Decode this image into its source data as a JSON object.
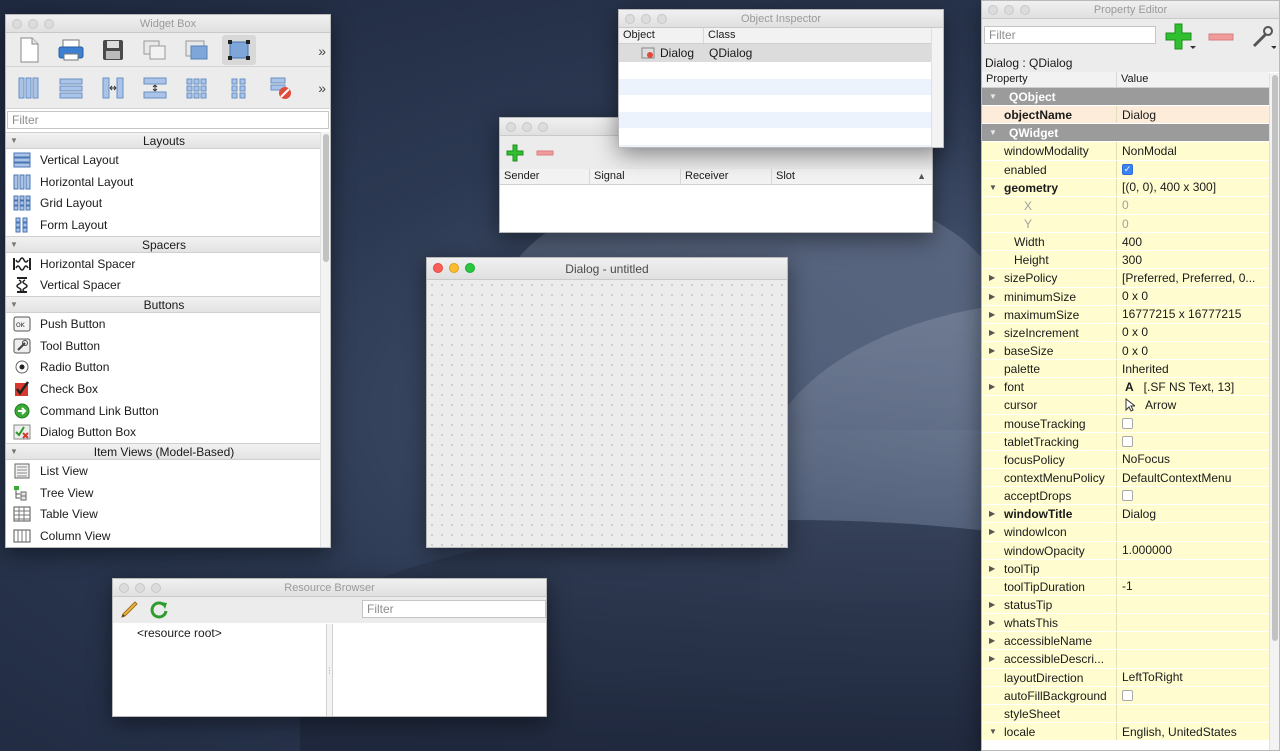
{
  "colors": {
    "accent": "#3b82f6",
    "prop_bg": "#fffdcf",
    "obj_bg": "#fdecd9",
    "category_bg": "#9b9b9b"
  },
  "widget_box": {
    "title": "Widget Box",
    "filter_placeholder": "Filter",
    "categories": [
      {
        "label": "Layouts",
        "items": [
          "Vertical Layout",
          "Horizontal Layout",
          "Grid Layout",
          "Form Layout"
        ]
      },
      {
        "label": "Spacers",
        "items": [
          "Horizontal Spacer",
          "Vertical Spacer"
        ]
      },
      {
        "label": "Buttons",
        "items": [
          "Push Button",
          "Tool Button",
          "Radio Button",
          "Check Box",
          "Command Link Button",
          "Dialog Button Box"
        ]
      },
      {
        "label": "Item Views (Model-Based)",
        "items": [
          "List View",
          "Tree View",
          "Table View",
          "Column View"
        ]
      }
    ]
  },
  "object_inspector": {
    "title": "Object Inspector",
    "col_object": "Object",
    "col_class": "Class",
    "row_object": "Dialog",
    "row_class": "QDialog"
  },
  "signal_editor": {
    "col_sender": "Sender",
    "col_signal": "Signal",
    "col_receiver": "Receiver",
    "col_slot": "Slot"
  },
  "dialog": {
    "title": "Dialog - untitled"
  },
  "resource_browser": {
    "title": "Resource Browser",
    "filter_placeholder": "Filter",
    "root": "<resource root>"
  },
  "property_editor": {
    "title": "Property Editor",
    "filter_placeholder": "Filter",
    "object_label": "Dialog : QDialog",
    "col_property": "Property",
    "col_value": "Value",
    "rows": [
      {
        "name": "QObject",
        "value": "",
        "kind": "cat",
        "arrow": "▼"
      },
      {
        "name": "objectName",
        "value": "Dialog",
        "kind": "o",
        "bold": true
      },
      {
        "name": "QWidget",
        "value": "",
        "kind": "cat",
        "arrow": "▼"
      },
      {
        "name": "windowModality",
        "value": "NonModal",
        "kind": "y"
      },
      {
        "name": "enabled",
        "value": "",
        "kind": "y",
        "checkbox": "on"
      },
      {
        "name": "geometry",
        "value": "[(0, 0), 400 x 300]",
        "kind": "y",
        "bold": true,
        "arrow": "▼"
      },
      {
        "name": "X",
        "value": "0",
        "kind": "y",
        "indent": 2,
        "disabled": true
      },
      {
        "name": "Y",
        "value": "0",
        "kind": "y",
        "indent": 2,
        "disabled": true
      },
      {
        "name": "Width",
        "value": "400",
        "kind": "y",
        "indent": 1
      },
      {
        "name": "Height",
        "value": "300",
        "kind": "y",
        "indent": 1
      },
      {
        "name": "sizePolicy",
        "value": "[Preferred, Preferred, 0...",
        "kind": "y",
        "arrow": "▶"
      },
      {
        "name": "minimumSize",
        "value": "0 x 0",
        "kind": "y",
        "arrow": "▶"
      },
      {
        "name": "maximumSize",
        "value": "16777215 x 16777215",
        "kind": "y",
        "arrow": "▶"
      },
      {
        "name": "sizeIncrement",
        "value": "0 x 0",
        "kind": "y",
        "arrow": "▶"
      },
      {
        "name": "baseSize",
        "value": "0 x 0",
        "kind": "y",
        "arrow": "▶"
      },
      {
        "name": "palette",
        "value": "Inherited",
        "kind": "y"
      },
      {
        "name": "font",
        "value": "[.SF NS Text, 13]",
        "kind": "y",
        "arrow": "▶",
        "icon": "font"
      },
      {
        "name": "cursor",
        "value": "Arrow",
        "kind": "y",
        "icon": "cursor"
      },
      {
        "name": "mouseTracking",
        "value": "",
        "kind": "y",
        "checkbox": "off"
      },
      {
        "name": "tabletTracking",
        "value": "",
        "kind": "y",
        "checkbox": "off"
      },
      {
        "name": "focusPolicy",
        "value": "NoFocus",
        "kind": "y"
      },
      {
        "name": "contextMenuPolicy",
        "value": "DefaultContextMenu",
        "kind": "y"
      },
      {
        "name": "acceptDrops",
        "value": "",
        "kind": "y",
        "checkbox": "off"
      },
      {
        "name": "windowTitle",
        "value": "Dialog",
        "kind": "y",
        "bold": true,
        "arrow": "▶"
      },
      {
        "name": "windowIcon",
        "value": "",
        "kind": "y",
        "arrow": "▶"
      },
      {
        "name": "windowOpacity",
        "value": "1.000000",
        "kind": "y"
      },
      {
        "name": "toolTip",
        "value": "",
        "kind": "y",
        "arrow": "▶"
      },
      {
        "name": "toolTipDuration",
        "value": "-1",
        "kind": "y"
      },
      {
        "name": "statusTip",
        "value": "",
        "kind": "y",
        "arrow": "▶"
      },
      {
        "name": "whatsThis",
        "value": "",
        "kind": "y",
        "arrow": "▶"
      },
      {
        "name": "accessibleName",
        "value": "",
        "kind": "y",
        "arrow": "▶"
      },
      {
        "name": "accessibleDescri...",
        "value": "",
        "kind": "y",
        "arrow": "▶"
      },
      {
        "name": "layoutDirection",
        "value": "LeftToRight",
        "kind": "y"
      },
      {
        "name": "autoFillBackground",
        "value": "",
        "kind": "y",
        "checkbox": "off"
      },
      {
        "name": "styleSheet",
        "value": "",
        "kind": "y"
      },
      {
        "name": "locale",
        "value": "English, UnitedStates",
        "kind": "y",
        "arrow": "▼"
      }
    ]
  }
}
